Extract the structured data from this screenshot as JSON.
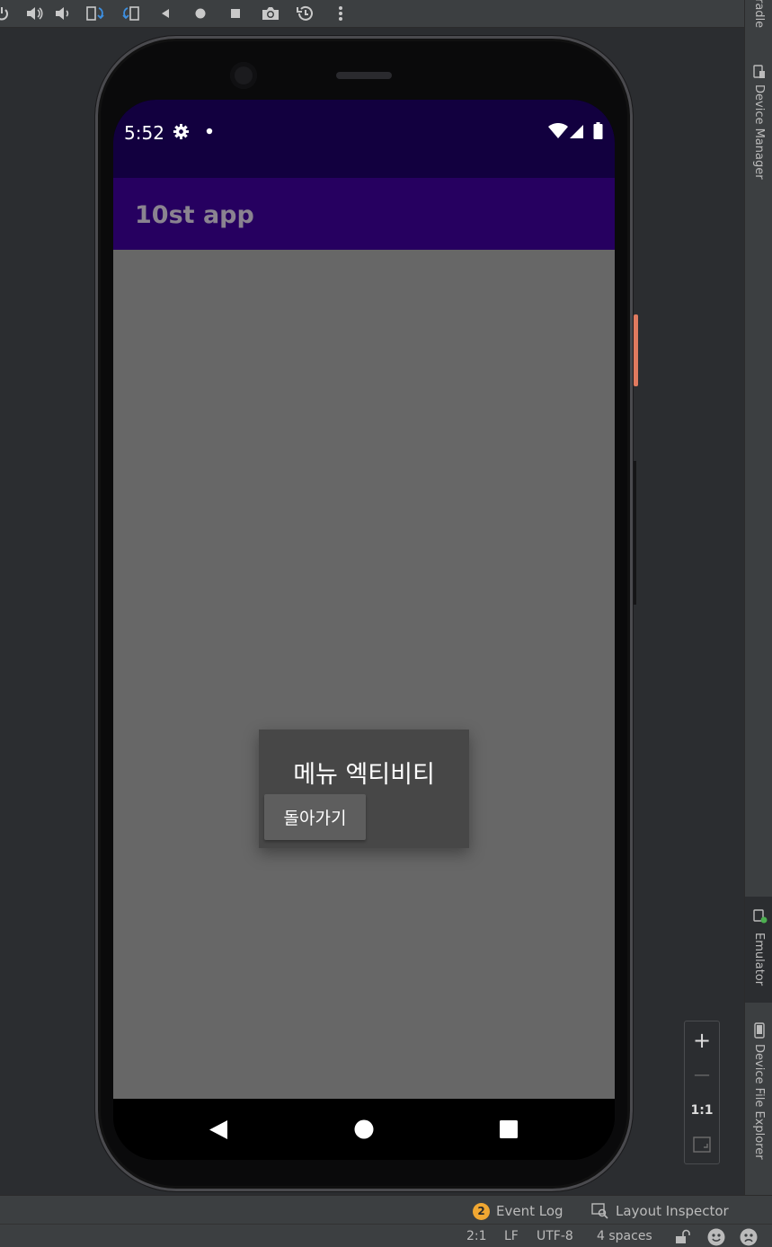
{
  "ide": {
    "toolbar_icons": [
      "power-icon",
      "volume-up-icon",
      "volume-down-icon",
      "rotate-left-icon",
      "rotate-right-icon",
      "back-icon",
      "home-icon",
      "overview-icon",
      "camera-icon",
      "snapshot-icon",
      "more-icon"
    ],
    "right_tabs": [
      {
        "label": "radle",
        "icon": ""
      },
      {
        "label": "Device Manager",
        "icon": "device-manager-icon"
      },
      {
        "label": "Emulator",
        "icon": "emulator-icon"
      },
      {
        "label": "Device File Explorer",
        "icon": "device-file-explorer-icon"
      }
    ],
    "bottom_tools": {
      "event_log_count": "2",
      "event_log_label": "Event Log",
      "layout_inspector_label": "Layout Inspector"
    },
    "status": {
      "position": "2:1",
      "line_separator": "LF",
      "encoding": "UTF-8",
      "indent": "4 spaces"
    },
    "zoom": {
      "in": "+",
      "out": "—",
      "actual": "1:1"
    },
    "colors": {
      "accent_orange": "#f0a732",
      "side_button": "#e07a5f"
    }
  },
  "device": {
    "status_bar": {
      "time": "5:52"
    },
    "app_bar": {
      "title": "10st app"
    },
    "dialog": {
      "title": "메뉴 엑티비티",
      "button_label": "돌아가기"
    },
    "colors": {
      "status_bar": "#12003f",
      "app_bar": "#260060",
      "content_bg": "#676767",
      "dialog_bg": "#474747"
    }
  }
}
